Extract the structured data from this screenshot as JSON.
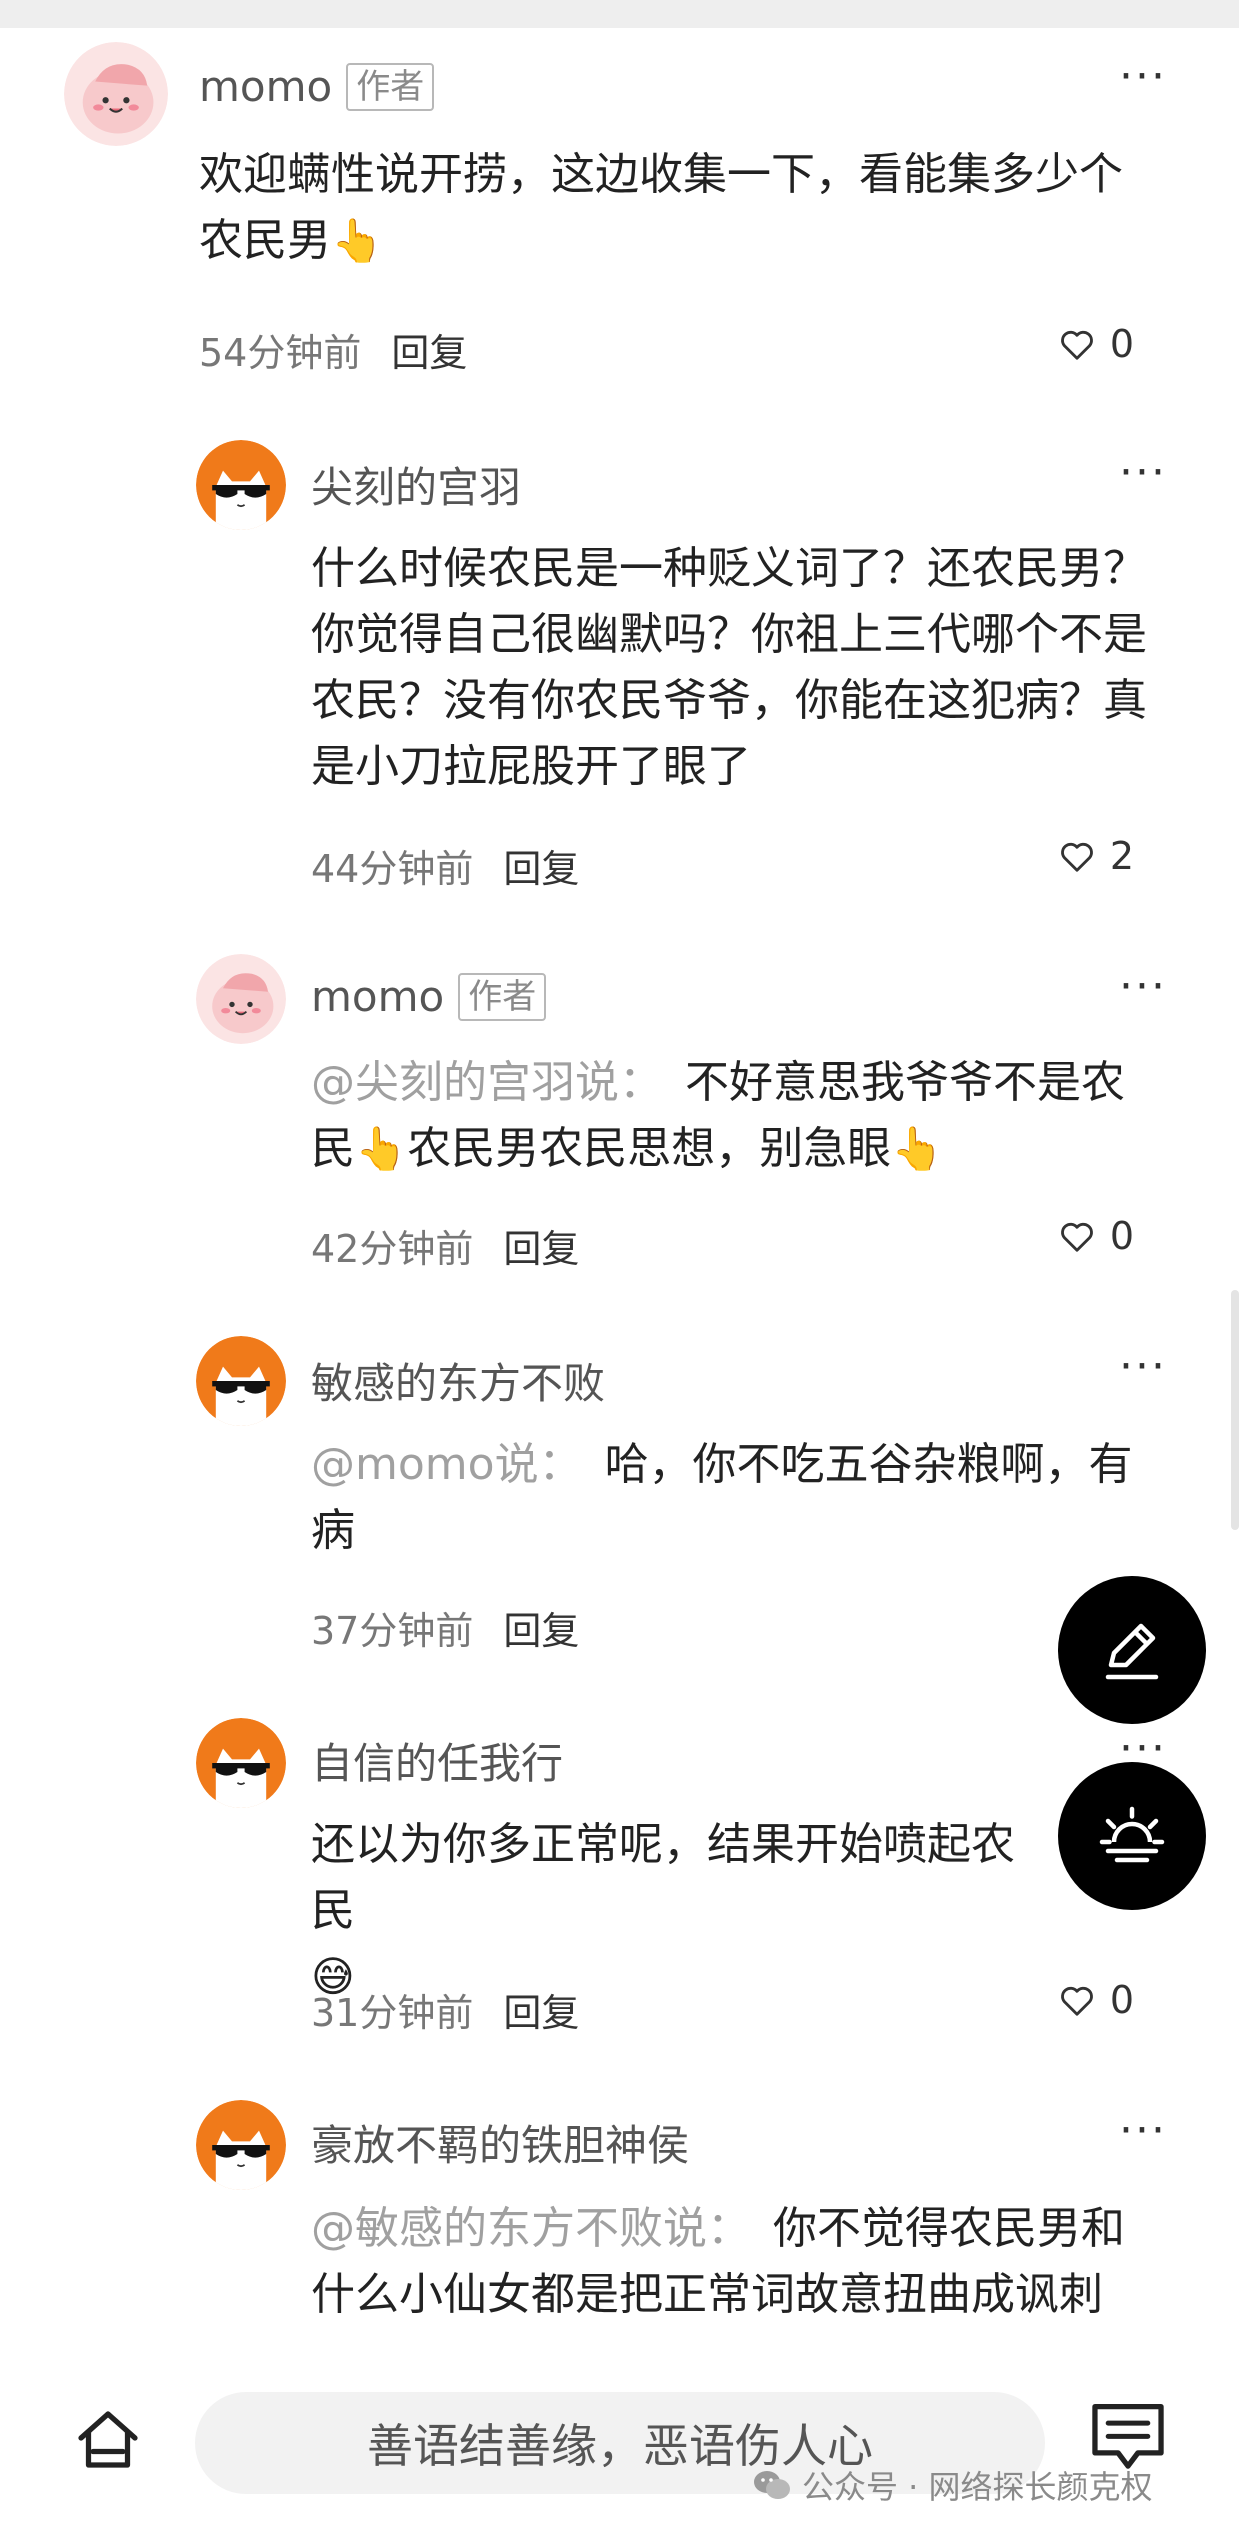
{
  "comments": [
    {
      "name": "momo",
      "author_tag": "作者",
      "text": "欢迎螨性说开捞，这边收集一下，看能集多少个农民男",
      "emoji": "👆",
      "time": "54分钟前",
      "reply": "回复",
      "likes": "0"
    },
    {
      "name": "尖刻的宫羽",
      "text": "什么时候农民是一种贬义词了？还农民男？你觉得自己很幽默吗？你祖上三代哪个不是农民？没有你农民爷爷，你能在这犯病？真是小刀拉屁股开了眼了",
      "time": "44分钟前",
      "reply": "回复",
      "likes": "2"
    },
    {
      "name": "momo",
      "author_tag": "作者",
      "mention": "@尖刻的宫羽说：",
      "text_a": "不好意思我爷爷不是农民",
      "emoji": "👆",
      "text_b": "农民男农民思想，别急眼",
      "time": "42分钟前",
      "reply": "回复",
      "likes": "0"
    },
    {
      "name": "敏感的东方不败",
      "mention": "@momo说：",
      "text": "哈，你不吃五谷杂粮啊，有病",
      "time": "37分钟前",
      "reply": "回复"
    },
    {
      "name": "自信的任我行",
      "text": "还以为你多正常呢，结果开始喷起农民",
      "emoji": "😅",
      "time": "31分钟前",
      "reply": "回复",
      "likes": "0"
    },
    {
      "name": "豪放不羁的铁胆神侯",
      "mention": "@敏感的东方不败说：",
      "text": "你不觉得农民男和什么小仙女都是把正常词故意扭曲成讽刺"
    }
  ],
  "bottom": {
    "input_placeholder": "善语结善缘，恶语伤人心",
    "watermark": "公众号 · 网络探长颜克权"
  },
  "icons": {
    "more": "more-dots-icon",
    "like": "heart-icon",
    "fab_edit": "pencil-icon",
    "fab_theme": "sun-moon-icon",
    "home": "home-icon",
    "comment": "comment-icon"
  },
  "colors": {
    "avatar_cat_bg": "#f07a1a",
    "avatar_momo_bg": "#fbe4e4",
    "mention": "#a0a0a0",
    "fab": "#000000"
  },
  "more_glyph": "···"
}
